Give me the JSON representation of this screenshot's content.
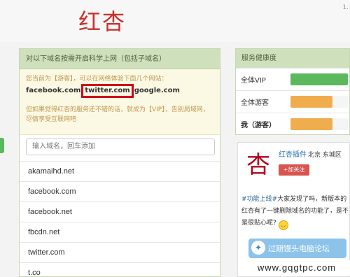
{
  "header": {
    "brand": "红杏",
    "corner": "1."
  },
  "left_panel": {
    "title": "对以下域名按需开启科学上网（包括子域名）",
    "notice": {
      "line1": "您当前为【游客】，可以在网络体验下面几个网站：",
      "domains_a": "facebook.com",
      "domains_b": "twitter.com",
      "domains_c": "google.com",
      "line3": "但如果觉得红杏的服务还不错的话，就成为【VIP】，告别局域网，尽情享受互联网吧"
    },
    "input_placeholder": "输入域名，回车添加",
    "domains": [
      "akamaihd.net",
      "facebook.com",
      "facebook.net",
      "fbcdn.net",
      "twitter.com",
      "t.co"
    ]
  },
  "health_panel": {
    "title": "服务健康度",
    "rows": [
      {
        "label": "全体VIP",
        "level": 1.0,
        "color": "#5cb85c"
      },
      {
        "label": "全体游客",
        "level": 0.73,
        "color": "#f0ad4e"
      },
      {
        "label": "我（游客）",
        "level": 0.73,
        "color": "#f0ad4e"
      }
    ]
  },
  "weibo": {
    "logo": "杏",
    "name": "红杏插件",
    "city": "北京 东城区",
    "follow": "+加关注",
    "tag": "#功能上线#",
    "text": "大家发现了吗，新版本的红杏有了一键删除域名的功能了，是不是很贴心呢?"
  },
  "watermark": {
    "text": "过期馒头电脑论坛",
    "url": "www.gqgtpc.com"
  }
}
